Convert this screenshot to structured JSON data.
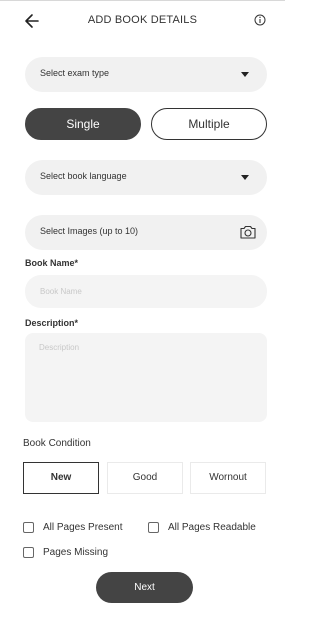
{
  "header": {
    "title": "ADD BOOK DETAILS",
    "back_icon": "arrow-left-icon",
    "info_icon": "info-circle-icon"
  },
  "exam_type": {
    "label": "Select exam type",
    "icon": "caret-down-icon"
  },
  "mode_toggle": {
    "single": "Single",
    "multiple": "Multiple",
    "selected": "Single"
  },
  "book_language": {
    "label": "Select book language",
    "icon": "caret-down-icon"
  },
  "images": {
    "label": "Select Images (up to 10)",
    "icon": "camera-icon"
  },
  "book_name": {
    "label": "Book Name*",
    "placeholder": "Book Name",
    "value": ""
  },
  "description": {
    "label": "Description*",
    "placeholder": "Description",
    "value": ""
  },
  "condition": {
    "title": "Book Condition",
    "options": [
      "New",
      "Good",
      "Wornout"
    ],
    "selected": "New"
  },
  "checks": {
    "all_pages_present": {
      "label": "All Pages Present",
      "checked": false
    },
    "all_pages_readable": {
      "label": "All Pages Readable",
      "checked": false
    },
    "pages_missing": {
      "label": "Pages Missing",
      "checked": false
    }
  },
  "next_button": {
    "label": "Next"
  },
  "colors": {
    "primary_dark": "#444444",
    "input_bg": "#f4f4f4",
    "placeholder": "#c8c8c8"
  }
}
